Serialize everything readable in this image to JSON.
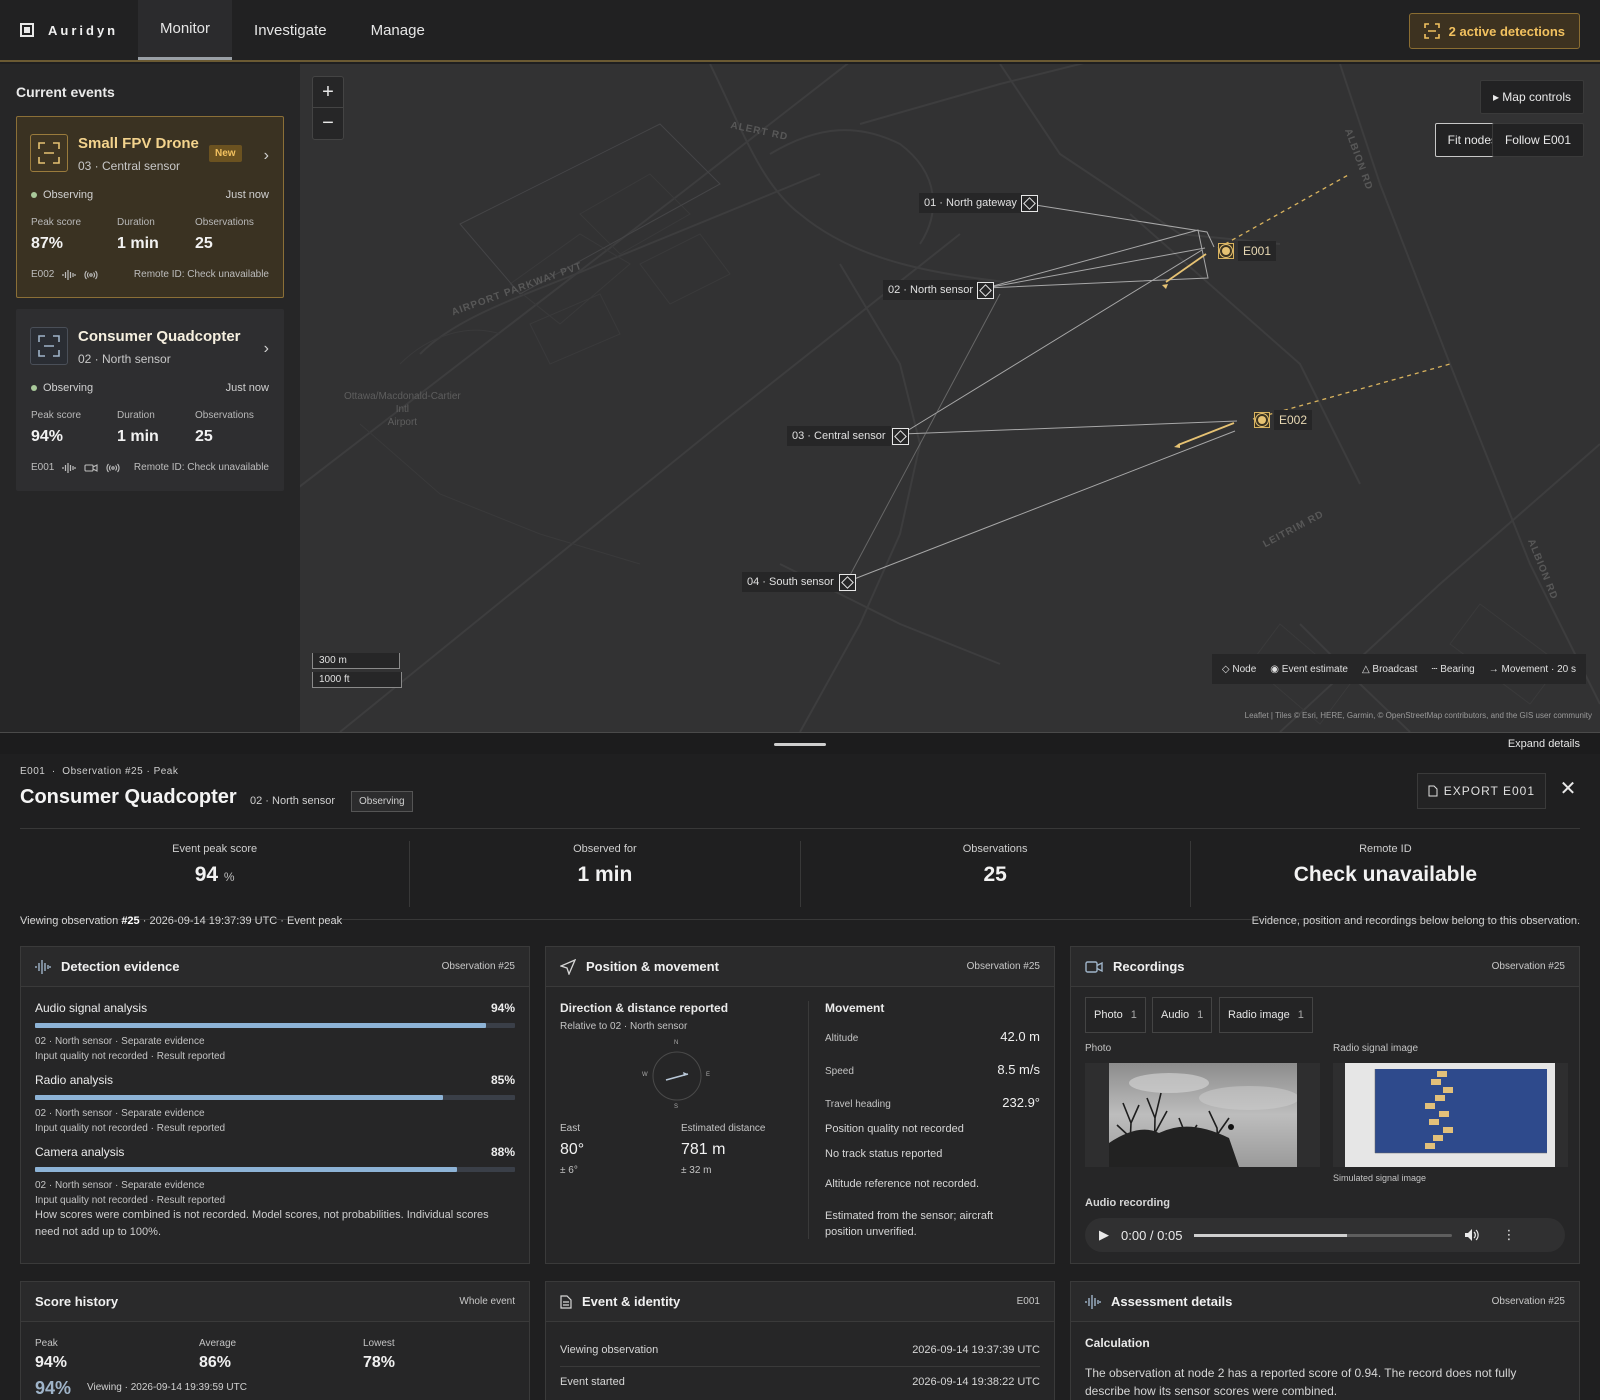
{
  "topbar": {
    "brand": "Auridyn",
    "tabs": [
      "Monitor",
      "Investigate",
      "Manage"
    ],
    "active_tab": "Monitor",
    "detections_label": "2 active detections"
  },
  "sidebar": {
    "title": "Current events",
    "cards": [
      {
        "title": "Small FPV Drone",
        "subtitle": "03 · Central sensor",
        "badge": "New",
        "status": "Observing",
        "time": "Just now",
        "stats": [
          {
            "label": "Peak score",
            "value": "87%"
          },
          {
            "label": "Duration",
            "value": "1 min"
          },
          {
            "label": "Observations",
            "value": "25"
          }
        ],
        "id": "E002",
        "remote": "Remote ID: Check unavailable"
      },
      {
        "title": "Consumer Quadcopter",
        "subtitle": "02 · North sensor",
        "status": "Observing",
        "time": "Just now",
        "stats": [
          {
            "label": "Peak score",
            "value": "94%"
          },
          {
            "label": "Duration",
            "value": "1 min"
          },
          {
            "label": "Observations",
            "value": "25"
          }
        ],
        "id": "E001",
        "remote": "Remote ID: Check unavailable"
      }
    ]
  },
  "map": {
    "zoom_in": "+",
    "zoom_out": "−",
    "map_controls": "▸ Map controls",
    "fit_nodes": "Fit nodes",
    "follow": "Follow E001",
    "nodes": [
      "01 · North gateway",
      "02 · North sensor",
      "03 · Central sensor",
      "04 · South sensor"
    ],
    "events": [
      "E001",
      "E002"
    ],
    "airport": [
      "Ottawa/Macdonald-Cartier",
      "Intl",
      "Airport"
    ],
    "roads": [
      "ALERT RD",
      "AIRPORT PARKWAY PVT",
      "ALBION RD",
      "LEITRIM RD",
      "ALBION RD"
    ],
    "scale": [
      "300 m",
      "1000 ft"
    ],
    "legend": [
      "Node",
      "Event estimate",
      "Broadcast",
      "Bearing",
      "Movement · 20 s"
    ],
    "attribution": "Leaflet | Tiles © Esri, HERE, Garmin, © OpenStreetMap contributors, and the GIS user community"
  },
  "splitter": {
    "expand": "Expand details"
  },
  "detail": {
    "crumb": "E001  ·  Observation #25 · Peak",
    "title": "Consumer Quadcopter",
    "sensor": "02 · North sensor",
    "status": "Observing",
    "export": "EXPORT E001",
    "close": "✕",
    "kpis": [
      {
        "label": "Event peak score",
        "value": "94",
        "unit": "%"
      },
      {
        "label": "Observed for",
        "value": "1 min",
        "unit": ""
      },
      {
        "label": "Observations",
        "value": "25",
        "unit": ""
      },
      {
        "label": "Remote ID",
        "value": "Check unavailable",
        "unit": ""
      }
    ],
    "viewing_prefix": "Viewing observation ",
    "viewing_num": "#25",
    "viewing_suffix": " · 2026-09-14 19:37:39 UTC · Event peak",
    "viewing_note": "Evidence, position and recordings below belong to this observation."
  },
  "evidence": {
    "title": "Detection evidence",
    "ref": "Observation #25",
    "items": [
      {
        "name": "Audio signal analysis",
        "pct": "94%",
        "value": 0.94,
        "meta1": "02 · North sensor · Separate evidence",
        "meta2": "Input quality not recorded · Result reported"
      },
      {
        "name": "Radio analysis",
        "pct": "85%",
        "value": 0.85,
        "meta1": "02 · North sensor · Separate evidence",
        "meta2": "Input quality not recorded · Result reported"
      },
      {
        "name": "Camera analysis",
        "pct": "88%",
        "value": 0.88,
        "meta1": "02 · North sensor · Separate evidence",
        "meta2": "Input quality not recorded · Result reported"
      }
    ],
    "note": "How scores were combined is not recorded. Model scores, not probabilities. Individual scores need not add up to 100%."
  },
  "position": {
    "title": "Position & movement",
    "ref": "Observation #25",
    "dir_title": "Direction & distance reported",
    "dir_sub": "Relative to 02 · North sensor",
    "compass": [
      "N",
      "E",
      "S",
      "W"
    ],
    "east_label": "East",
    "east_value": "80°",
    "east_tol": "± 6°",
    "dist_label": "Estimated distance",
    "dist_value": "781 m",
    "dist_tol": "± 32 m",
    "mv_title": "Movement",
    "altitude_label": "Altitude",
    "altitude": "42.0 m",
    "speed_label": "Speed",
    "speed": "8.5 m/s",
    "heading_label": "Travel heading",
    "heading": "232.9°",
    "notes": [
      "Position quality not recorded",
      "No track status reported",
      "Altitude reference not recorded.",
      "Estimated from the sensor; aircraft position unverified."
    ]
  },
  "recordings": {
    "title": "Recordings",
    "ref": "Observation #25",
    "chips": [
      {
        "label": "Photo",
        "count": "1"
      },
      {
        "label": "Audio",
        "count": "1"
      },
      {
        "label": "Radio image",
        "count": "1"
      }
    ],
    "photo_label": "Photo",
    "radio_label": "Radio signal image",
    "radio_caption": "Simulated signal image",
    "audio_label": "Audio recording",
    "audio_time": "0:00 / 0:05",
    "audio_progress": 0.59
  },
  "history": {
    "title": "Score history",
    "ref": "Whole event",
    "stats": [
      {
        "label": "Peak",
        "value": "94%"
      },
      {
        "label": "Average",
        "value": "86%"
      },
      {
        "label": "Lowest",
        "value": "78%"
      }
    ],
    "current": "94%",
    "current_note": "Viewing · 2026-09-14 19:39:59 UTC"
  },
  "identity": {
    "title": "Event & identity",
    "ref": "E001",
    "rows": [
      {
        "label": "Viewing observation",
        "value": "2026-09-14 19:37:39 UTC"
      },
      {
        "label": "Event started",
        "value": "2026-09-14 19:38:22 UTC"
      }
    ]
  },
  "assessment": {
    "title": "Assessment details",
    "ref": "Observation #25",
    "calc_title": "Calculation",
    "calc_text": "The observation at node 2 has a reported score of 0.94. The record does not fully describe how its sensor scores were combined."
  }
}
